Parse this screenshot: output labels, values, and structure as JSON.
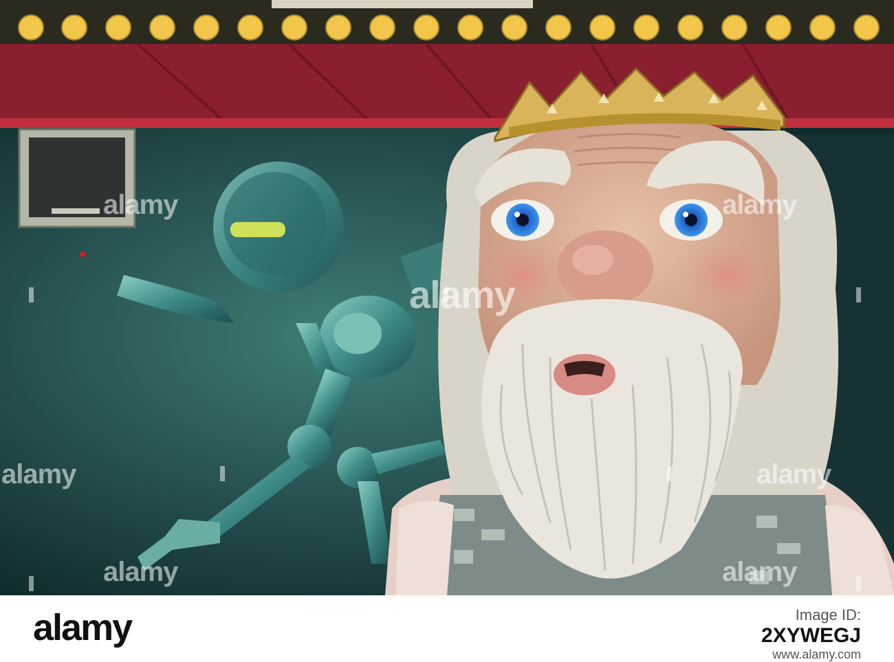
{
  "photo": {
    "subject": "photo",
    "watermark_text": "alamy"
  },
  "footer": {
    "logo": "alamy",
    "label": "Image ID:",
    "image_id": "2XYWEGJ",
    "url": "www.alamy.com"
  },
  "colors": {
    "marquee_bulb": "#f2c64a",
    "canopy_red": "#8a1f30",
    "robot_teal": "#4fa7a2",
    "beard_white": "#ece8df",
    "eye_blue": "#2a7fd8",
    "crown_gold": "#d9b45a"
  }
}
